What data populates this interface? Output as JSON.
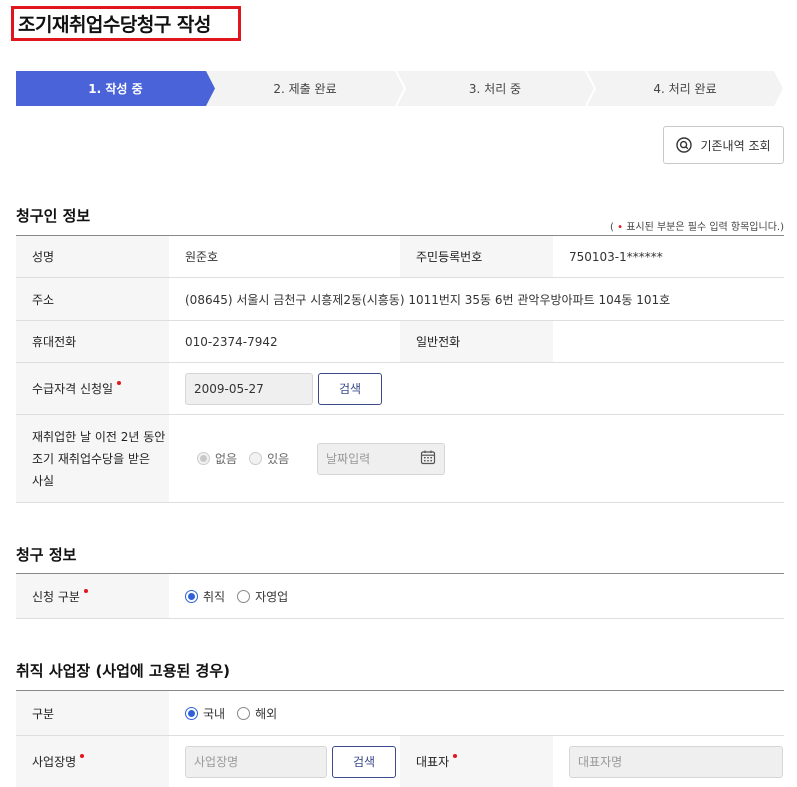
{
  "page_title": "조기재취업수당청구 작성",
  "steps": [
    {
      "label": "1. 작성 중",
      "active": true
    },
    {
      "label": "2. 제출 완료",
      "active": false
    },
    {
      "label": "3. 처리 중",
      "active": false
    },
    {
      "label": "4. 처리 완료",
      "active": false
    }
  ],
  "history_button": {
    "label": "기존내역 조회",
    "icon": "search-icon"
  },
  "required_note": {
    "open": "( ",
    "dot": "•",
    "text": " 표시된 부분은 필수 입력 항목입니다.)"
  },
  "claimant": {
    "title": "청구인 정보",
    "name_label": "성명",
    "name_value": "원준호",
    "rrn_label": "주민등록번호",
    "rrn_value": "750103-1******",
    "address_label": "주소",
    "address_value": "(08645) 서울시 금천구 시흥제2동(시흥동) 1011번지 35동 6번 관악우방아파트 104동 101호",
    "mobile_label": "휴대전화",
    "mobile_value": "010-2374-7942",
    "phone_label": "일반전화",
    "phone_value": "",
    "qualify_label": "수급자격 신청일",
    "qualify_value": "2009-05-27",
    "search_label": "검색",
    "prev_label_1": "재취업한 날 이전 2년 동안",
    "prev_label_2": "조기 재취업수당을 받은",
    "prev_label_3": "사실",
    "prev_options": [
      "없음",
      "있음"
    ],
    "date_placeholder": "날짜입력"
  },
  "claim": {
    "title": "청구 정보",
    "type_label": "신청 구분",
    "type_options": [
      "취직",
      "자영업"
    ]
  },
  "workplace": {
    "title": "취직 사업장 (사업에 고용된 경우)",
    "division_label": "구분",
    "division_options": [
      "국내",
      "해외"
    ],
    "workplace_label": "사업장명",
    "workplace_placeholder": "사업장명",
    "search_label": "검색",
    "ceo_label": "대표자",
    "ceo_placeholder": "대표자명"
  },
  "colors": {
    "accent": "#4a63d8",
    "required": "#e0161c",
    "radio": "#2f62d6"
  }
}
